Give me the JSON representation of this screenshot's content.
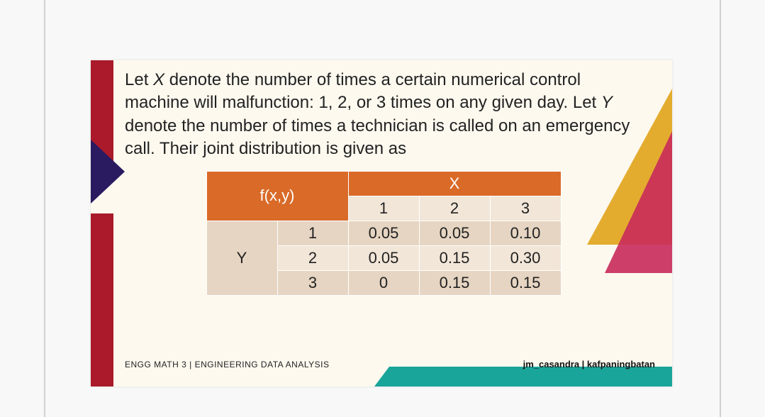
{
  "problem_text": {
    "line1a": "Let ",
    "x": "X ",
    "line1b": "denote the number of times a certain numerical control machine will malfunction: 1, 2, or 3 times on any given day. Let  ",
    "y": "Y ",
    "line1c": "denote the number of times a technician is called on an emergency call. Their joint distribution is given as"
  },
  "table": {
    "fxy": "f(x,y)",
    "X": "X",
    "Y": "Y",
    "x_levels": [
      "1",
      "2",
      "3"
    ],
    "y_levels": [
      "1",
      "2",
      "3"
    ],
    "rows": [
      [
        "0.05",
        "0.05",
        "0.10"
      ],
      [
        "0.05",
        "0.15",
        "0.30"
      ],
      [
        "0",
        "0.15",
        "0.15"
      ]
    ]
  },
  "footer": {
    "left": "ENGG MATH 3 | ENGINEERING DATA ANALYSIS",
    "right": "jm_casandra | kafpaningbatan"
  },
  "chart_data": {
    "type": "table",
    "title": "Joint probability distribution f(x,y)",
    "x_variable": "X (machine malfunctions per day)",
    "y_variable": "Y (emergency technician calls)",
    "x_levels": [
      1,
      2,
      3
    ],
    "y_levels": [
      1,
      2,
      3
    ],
    "matrix": [
      [
        0.05,
        0.05,
        0.1
      ],
      [
        0.05,
        0.15,
        0.3
      ],
      [
        0.0,
        0.15,
        0.15
      ]
    ]
  }
}
